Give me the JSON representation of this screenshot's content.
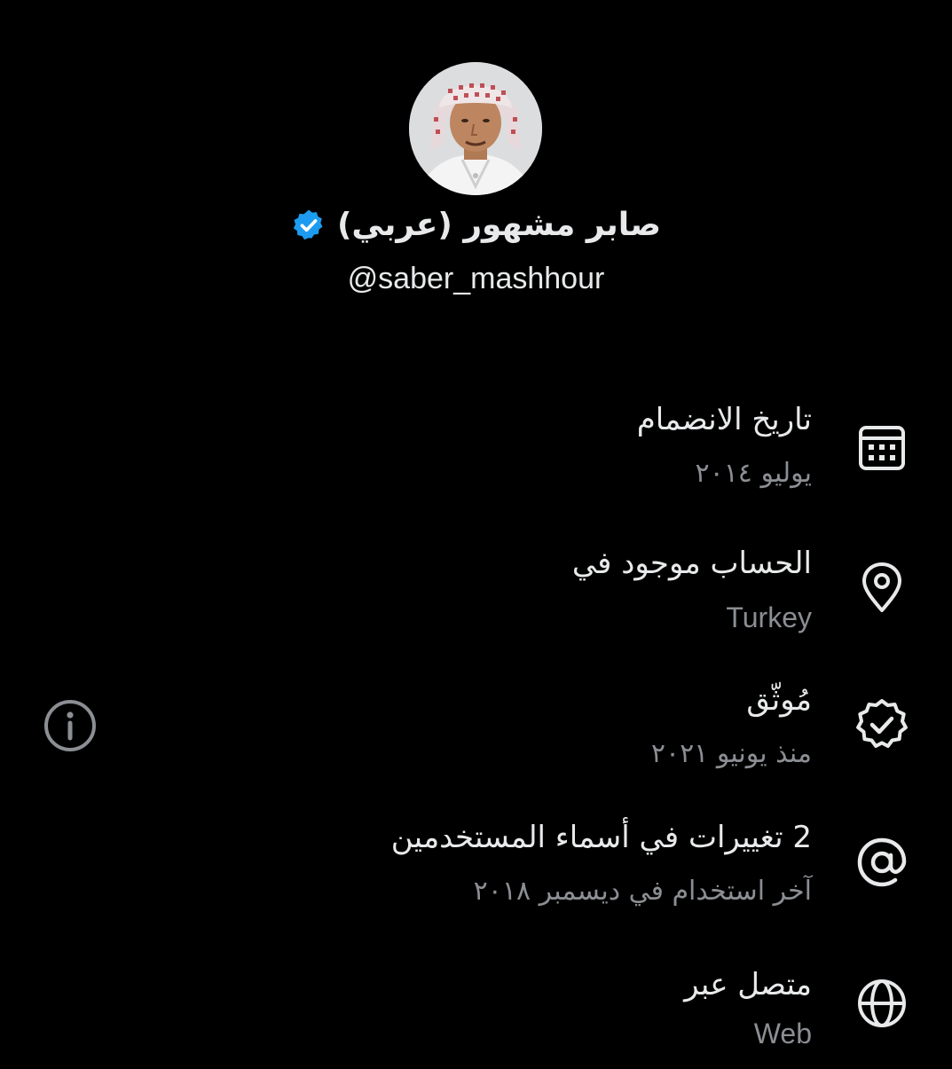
{
  "profile": {
    "display_name": "صابر مشهور (عربي)",
    "handle": "@saber_mashhour",
    "verified": true
  },
  "colors": {
    "background": "#000000",
    "primary_text": "#e7e9ea",
    "secondary_text": "#8b8e93",
    "verified_blue": "#1d9bf0",
    "icon_stroke": "#e7e9ea",
    "info_icon": "#8b8e93"
  },
  "about_rows": [
    {
      "icon": "calendar-icon",
      "title": "تاريخ الانضمام",
      "subtitle": "يوليو ٢٠١٤"
    },
    {
      "icon": "location-pin-icon",
      "title": "الحساب موجود في",
      "subtitle": "Turkey"
    },
    {
      "icon": "verified-seal-icon",
      "title": "مُوثّق",
      "subtitle": "منذ يونيو ٢٠٢١"
    },
    {
      "icon": "at-sign-icon",
      "title": "2 تغييرات في أسماء المستخدمين",
      "subtitle": "آخر استخدام في ديسمبر ٢٠١٨"
    },
    {
      "icon": "globe-icon",
      "title": "متصل عبر",
      "subtitle": "Web"
    }
  ],
  "info_button": {
    "icon": "info-icon"
  }
}
